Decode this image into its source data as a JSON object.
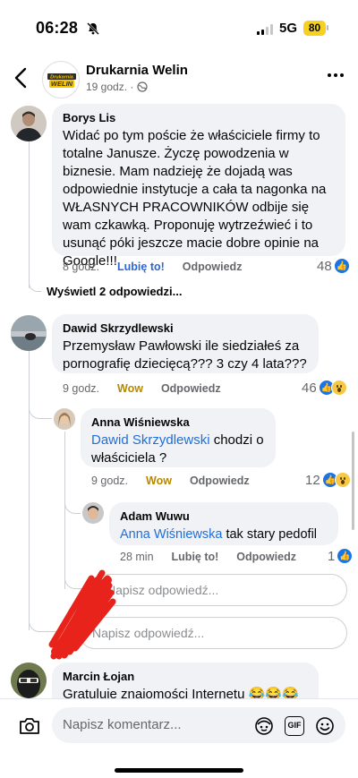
{
  "status_bar": {
    "time": "06:28",
    "network": "5G",
    "battery": "80"
  },
  "header": {
    "page_name": "Drukarnia Welin",
    "meta": "19 godz. ·",
    "logo_text_top": "Drukarnia",
    "logo_text_bottom": "WELIN"
  },
  "comments": [
    {
      "author": "Borys Lis",
      "text": "Widać po tym poście że właściciele firmy to totalne Janusze. Życzę powodzenia w biznesie. Mam nadzieję że dojadą was odpowiednie instytucje a cała ta nagonka na WŁASNYCH PRACOWNIKÓW odbije się wam czkawką. Proponuję wytrzeźwieć i to usunąć póki jeszcze macie dobre opinie na Google!!!",
      "time": "8 godz.",
      "reaction_action": "Lubię to!",
      "reply": "Odpowiedz",
      "count": "48"
    },
    {
      "author": "Dawid Skrzydlewski",
      "text": "Przemysław Pawłowski ile siedziałeś za pornografię dziecięcą??? 3 czy 4 lata???",
      "time": "9 godz.",
      "reaction_action": "Wow",
      "reply": "Odpowiedz",
      "count": "46"
    },
    {
      "author": "Anna Wiśniewska",
      "mention": "Dawid Skrzydlewski",
      "text": " chodzi o właściciela ?",
      "time": "9 godz.",
      "reaction_action": "Wow",
      "reply": "Odpowiedz",
      "count": "12"
    },
    {
      "author": "Adam Wuwu",
      "mention": "Anna Wiśniewska",
      "text": " tak stary pedofil",
      "time": "28 min",
      "reaction_action": "Lubię to!",
      "reply": "Odpowiedz",
      "count": "1"
    },
    {
      "author": "Marcin Łojan",
      "text": "Gratuluję znajomości Internetu 😂😂😂"
    }
  ],
  "view_replies": "Wyświetl 2 odpowiedzi...",
  "reply_placeholder": "Napisz odpowiedź...",
  "composer": {
    "placeholder": "Napisz komentarz...",
    "gif_label": "GIF"
  },
  "colors": {
    "link_blue": "#216fdb",
    "like_blue": "#1b74e4",
    "wow_yellow": "#f7c846",
    "bubble_gray": "#f0f2f5",
    "redaction_red": "#e8231c"
  },
  "icons": [
    "bell-off-icon",
    "signal-icon",
    "back-arrow-icon",
    "globe-icon",
    "more-icon",
    "like-reaction-icon",
    "wow-reaction-icon",
    "camera-icon",
    "avatar-sticker-icon",
    "gif-icon",
    "emoji-icon"
  ]
}
